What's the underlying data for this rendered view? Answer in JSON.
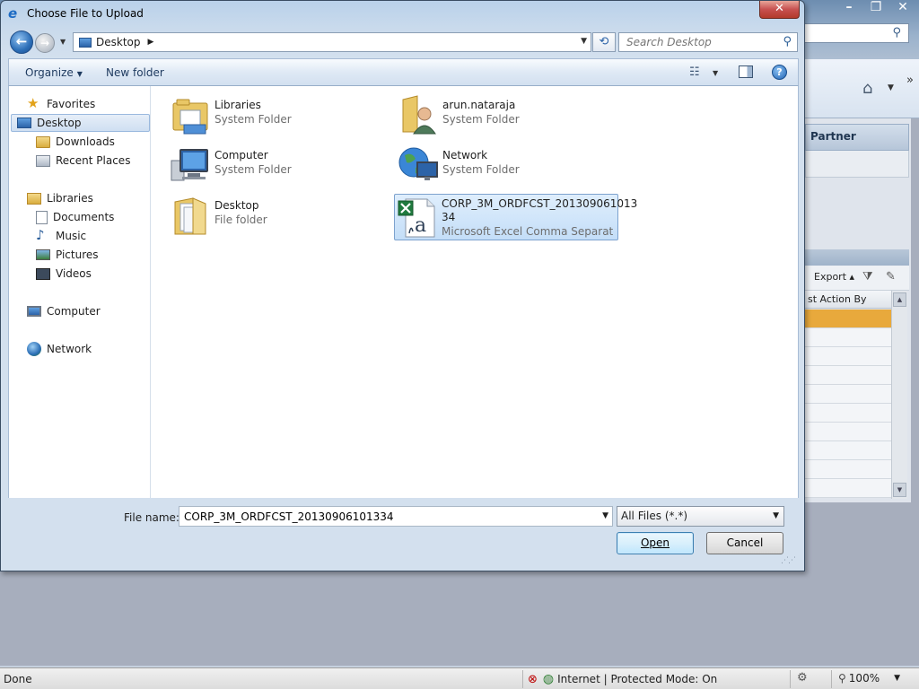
{
  "dialog": {
    "title": "Choose File to Upload",
    "close_label": "✕"
  },
  "navbar": {
    "location": "Desktop",
    "search_placeholder": "Search Desktop"
  },
  "toolbar": {
    "organize_label": "Organize",
    "new_folder_label": "New folder"
  },
  "nav_pane": {
    "favorites": {
      "label": "Favorites",
      "items": [
        "Desktop",
        "Downloads",
        "Recent Places"
      ]
    },
    "libraries": {
      "label": "Libraries",
      "items": [
        "Documents",
        "Music",
        "Pictures",
        "Videos"
      ]
    },
    "computer": "Computer",
    "network": "Network",
    "selected": "Desktop"
  },
  "files": [
    {
      "name": "Libraries",
      "type": "System Folder",
      "icon": "libraries-icon"
    },
    {
      "name": "arun.nataraja",
      "type": "System Folder",
      "icon": "user-folder-icon"
    },
    {
      "name": "Computer",
      "type": "System Folder",
      "icon": "computer-icon"
    },
    {
      "name": "Network",
      "type": "System Folder",
      "icon": "network-icon"
    },
    {
      "name": "Desktop",
      "type": "File folder",
      "icon": "folder-icon"
    },
    {
      "name": "CORP_3M_ORDFCST_201309061013\n34",
      "type": "Microsoft Excel Comma Separate...",
      "icon": "excel-csv-icon",
      "selected": true
    }
  ],
  "bottom": {
    "file_name_label": "File name:",
    "file_name_value": "CORP_3M_ORDFCST_20130906101334",
    "filter_value": "All Files (*.*)",
    "open_label": "Open",
    "cancel_label": "Cancel"
  },
  "background": {
    "partner_header": "Partner",
    "export_label": "Export",
    "column_header": "st Action By"
  },
  "status_bar": {
    "left_text": "Done",
    "zone_text": "Internet | Protected Mode: On",
    "zoom_text": "100%"
  },
  "colors": {
    "selection_bg": "#cfe3f8",
    "selected_row_bg": "#e8a93c",
    "close_button": "#c75050"
  }
}
